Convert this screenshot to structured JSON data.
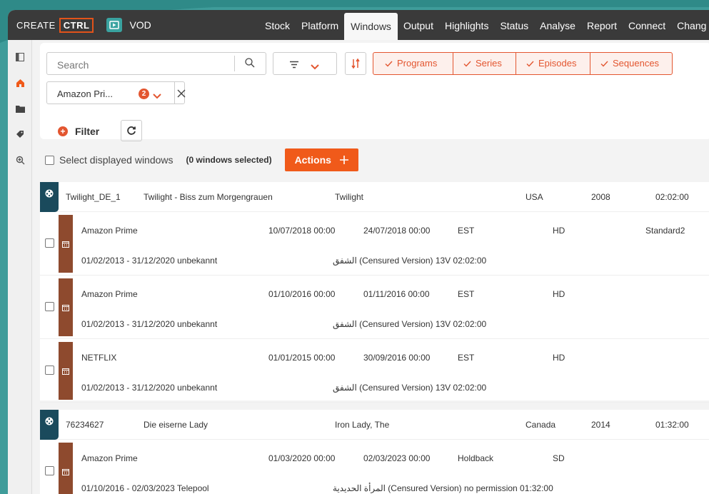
{
  "brand": {
    "create": "CREATE",
    "ctrl": "CTRL",
    "module": "VOD"
  },
  "nav": [
    "Stock",
    "Platform",
    "Windows",
    "Output",
    "Highlights",
    "Status",
    "Analyse",
    "Report",
    "Connect",
    "Chang"
  ],
  "nav_active": "Windows",
  "search": {
    "placeholder": "Search"
  },
  "type_filters": [
    "Programs",
    "Series",
    "Episodes",
    "Sequences"
  ],
  "platform_chip": {
    "label": "Amazon Pri...",
    "count": "2"
  },
  "filter_label": "Filter",
  "select_bar": {
    "label": "Select displayed windows",
    "count": "(0 windows selected)",
    "actions": "Actions"
  },
  "groups": [
    {
      "id": "Twilight_DE_1",
      "title": "Twilight - Biss zum Morgengrauen",
      "original": "Twilight",
      "country": "USA",
      "year": "2008",
      "duration": "02:02:00",
      "windows": [
        {
          "platform": "Amazon Prime",
          "start": "10/07/2018 00:00",
          "end": "24/07/2018 00:00",
          "type": "EST",
          "quality": "HD",
          "tier": "Standard2",
          "rights": "01/02/2013 - 31/12/2020 unbekannt",
          "version": "الشفق (Censured Version) 13V 02:02:00"
        },
        {
          "platform": "Amazon Prime",
          "start": "01/10/2016 00:00",
          "end": "01/11/2016 00:00",
          "type": "EST",
          "quality": "HD",
          "tier": "",
          "rights": "01/02/2013 - 31/12/2020 unbekannt",
          "version": "الشفق (Censured Version) 13V 02:02:00"
        },
        {
          "platform": "NETFLIX",
          "start": "01/01/2015 00:00",
          "end": "30/09/2016 00:00",
          "type": "EST",
          "quality": "HD",
          "tier": "",
          "rights": "01/02/2013 - 31/12/2020 unbekannt",
          "version": "الشفق (Censured Version) 13V 02:02:00"
        }
      ]
    },
    {
      "id": "76234627",
      "title": "Die eiserne Lady",
      "original": "Iron Lady, The",
      "country": "Canada",
      "year": "2014",
      "duration": "01:32:00",
      "windows": [
        {
          "platform": "Amazon Prime",
          "start": "01/03/2020 00:00",
          "end": "02/03/2023 00:00",
          "type": "Holdback",
          "quality": "SD",
          "tier": "",
          "rights": "01/10/2016 - 02/03/2023 Telepool",
          "version": "المرأة الحديدية (Censured Version) no permission 01:32:00"
        }
      ]
    }
  ],
  "colors": {
    "accent": "#e35630",
    "topbar": "#3a3a3a",
    "background": "#3f9c9a",
    "group_icon": "#1a4a5c",
    "window_strip": "#8e4a2e"
  }
}
